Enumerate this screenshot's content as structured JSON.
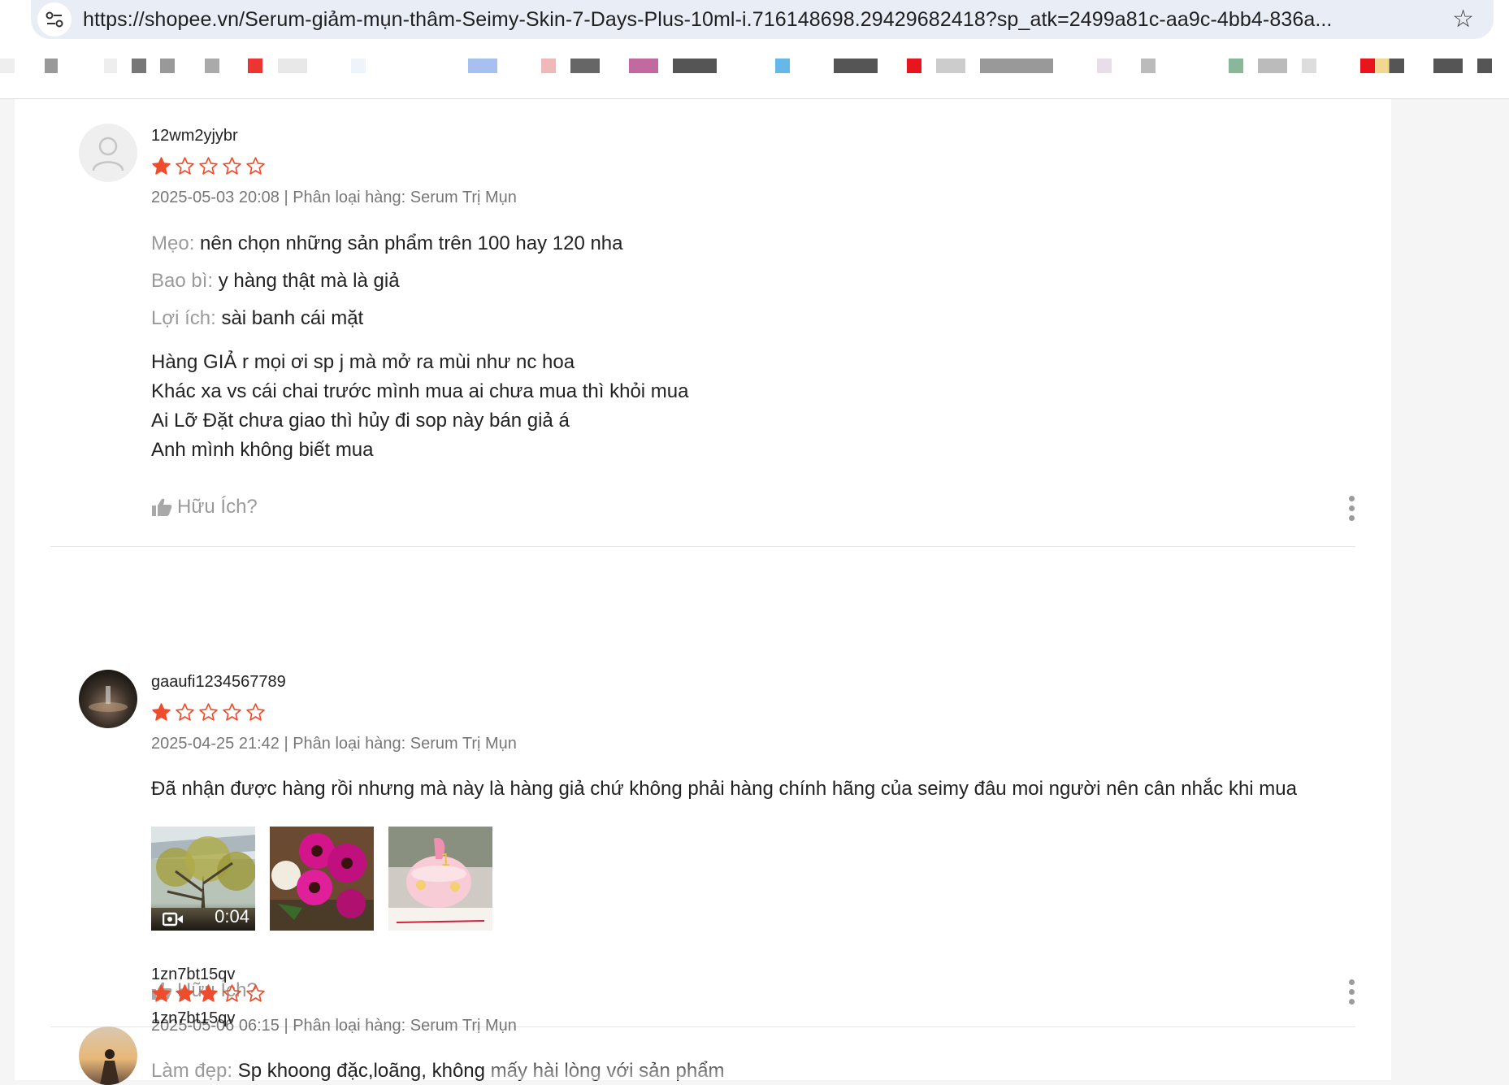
{
  "browser": {
    "url": "https://shopee.vn/Serum-giảm-mụn-thâm-Seimy-Skin-7-Days-Plus-10ml-i.716148698.29429682418?sp_atk=2499a81c-aa9c-4bb4-836a..."
  },
  "reviews": [
    {
      "username": "12wm2yjybr",
      "rating": 1,
      "meta": "2025-05-03 20:08 | Phân loại hàng: Serum Trị Mụn",
      "attributes": [
        {
          "key": "Mẹo:",
          "value": "nên chọn những sản phẩm trên 100 hay 120 nha"
        },
        {
          "key": "Bao bì:",
          "value": "y hàng thật mà là giả"
        },
        {
          "key": "Lợi ích:",
          "value": "sài banh cái mặt"
        }
      ],
      "body_lines": [
        "Hàng GIẢ r mọi ơi sp j mà mở ra mùi như nc hoa",
        "Khác xa vs cái chai trước mình mua ai chưa mua thì khỏi mua",
        "Ai Lỡ Đặt chưa giao thì hủy đi sop này bán giả á",
        "Anh mình không biết mua"
      ],
      "helpful_label": "Hữu Ích?"
    },
    {
      "username": "gaaufi1234567789",
      "rating": 1,
      "meta": "2025-04-25 21:42 | Phân loại hàng: Serum Trị Mụn",
      "body_lines": [
        "Đã nhận được hàng rồi nhưng mà này là hàng giả chứ không phải hàng chính hãng của seimy đâu moi người nên cân nhắc khi mua"
      ],
      "video_duration": "0:04",
      "helpful_label": "Hữu Ích?"
    },
    {
      "username": "1zn7bt15qv",
      "rating": 3,
      "meta": "2025-05-06 06:15 | Phân loại hàng: Serum Trị Mụn",
      "attributes": [
        {
          "key": "Làm đẹp:",
          "value": "Sp khoong đặc,loãng, không mấy hài lòng với sản phẩm"
        }
      ]
    }
  ],
  "colors": {
    "star": "#ee4d2d",
    "muted": "#757575",
    "divider": "#e5e5e5"
  },
  "icons": {
    "site_info": "tune-icon",
    "bookmark": "star-outline-icon",
    "helpful": "thumbs-up-icon",
    "more": "more-vertical-icon",
    "video": "video-camera-icon"
  }
}
